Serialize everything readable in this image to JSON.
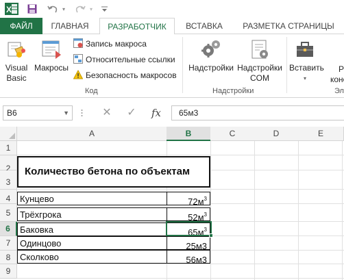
{
  "colors": {
    "accent": "#217346",
    "file_tab_text": "#ffffff",
    "border": "#d4d4d4"
  },
  "qat": {
    "icons": [
      "excel-logo-icon",
      "save-icon",
      "undo-icon",
      "redo-icon",
      "customize-qat-icon"
    ],
    "excel_letter": "X"
  },
  "tabs": [
    {
      "label": "ФАЙЛ"
    },
    {
      "label": "ГЛАВНАЯ"
    },
    {
      "label": "РАЗРАБОТЧИК"
    },
    {
      "label": "ВСТАВКА"
    },
    {
      "label": "РАЗМЕТКА СТРАНИЦЫ"
    }
  ],
  "ribbon": {
    "code_group": {
      "visual_basic": "Visual\nBasic",
      "macros": "Макросы",
      "record_macro": "Запись макроса",
      "relative_refs": "Относительные ссылки",
      "macro_security": "Безопасность макросов",
      "label": "Код"
    },
    "addins_group": {
      "addins": "Надстройки",
      "com_addins": "Надстройки\nCOM",
      "label": "Надстройки"
    },
    "controls_group": {
      "insert": "Вставить",
      "insert_arrow": "▾",
      "partial_label_1": "Р",
      "partial_label_2": "конс",
      "group_label_partial": "Эл"
    }
  },
  "formula_bar": {
    "name_box": "B6",
    "cancel": "✕",
    "enter": "✓",
    "fx": "fx",
    "value": "65м3"
  },
  "grid": {
    "columns": [
      "A",
      "B",
      "C",
      "D",
      "E"
    ],
    "selected_column": "B",
    "rows": [
      "1",
      "2",
      "3",
      "4",
      "5",
      "6",
      "7",
      "8",
      "9"
    ],
    "selected_row": "6",
    "title": "Количество бетона по объектам",
    "data": [
      {
        "name": "Кунцево",
        "value": "72м",
        "sup": "3"
      },
      {
        "name": "Трёхгрока",
        "value": "52м",
        "sup": "3"
      },
      {
        "name": "Баковка",
        "value": "65м",
        "sup": "3"
      },
      {
        "name": "Одинцово",
        "value": "25м3",
        "sup": ""
      },
      {
        "name": "Сколково",
        "value": "56м3",
        "sup": ""
      }
    ]
  }
}
